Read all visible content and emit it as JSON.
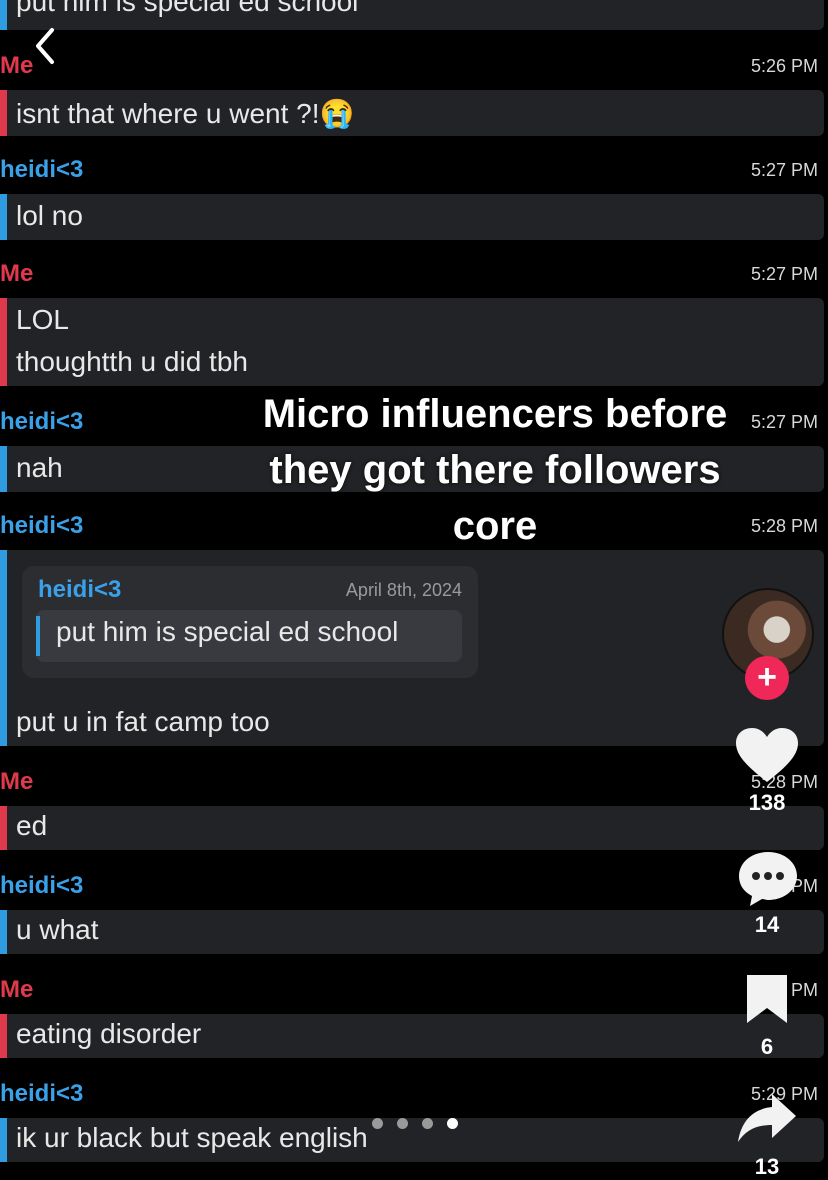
{
  "header": {
    "back_icon": "chevron-left-icon"
  },
  "chat": {
    "top_partial_text": "put him is special ed school",
    "messages": [
      {
        "sender": "Me",
        "time": "5:26 PM",
        "lines": [
          "isnt that where u went ?!"
        ],
        "emoji": "😭"
      },
      {
        "sender": "heidi<3",
        "time": "5:27 PM",
        "lines": [
          "lol no"
        ]
      },
      {
        "sender": "Me",
        "time": "5:27 PM",
        "lines": [
          "LOL",
          "thoughtth u did tbh"
        ]
      },
      {
        "sender": "heidi<3",
        "time": "5:27 PM",
        "lines": [
          "nah"
        ]
      },
      {
        "sender": "heidi<3",
        "time": "5:28 PM",
        "lines": [
          "put u in fat camp too"
        ],
        "reply": {
          "sender": "heidi<3",
          "date": "April 8th, 2024",
          "text": "put him is special ed school"
        }
      },
      {
        "sender": "Me",
        "time": "5:28 PM",
        "lines": [
          "ed"
        ]
      },
      {
        "sender": "heidi<3",
        "time": "5:29 PM",
        "lines": [
          "u what"
        ]
      },
      {
        "sender": "Me",
        "time": "5:29 PM",
        "lines": [
          "eating disorder"
        ]
      },
      {
        "sender": "heidi<3",
        "time": "5:29 PM",
        "lines": [
          "ik ur black but speak english"
        ]
      }
    ]
  },
  "overlay_caption": [
    "Micro influencers before",
    "they got there followers",
    "core"
  ],
  "side_actions": {
    "like_count": "138",
    "comment_count": "14",
    "bookmark_count": "6",
    "share_count": "13",
    "follow_label": "+"
  },
  "carousel": {
    "total": 4,
    "active_index": 3
  },
  "colors": {
    "me": "#e0394b",
    "heidi": "#2f9be0",
    "follow": "#f0285a"
  }
}
